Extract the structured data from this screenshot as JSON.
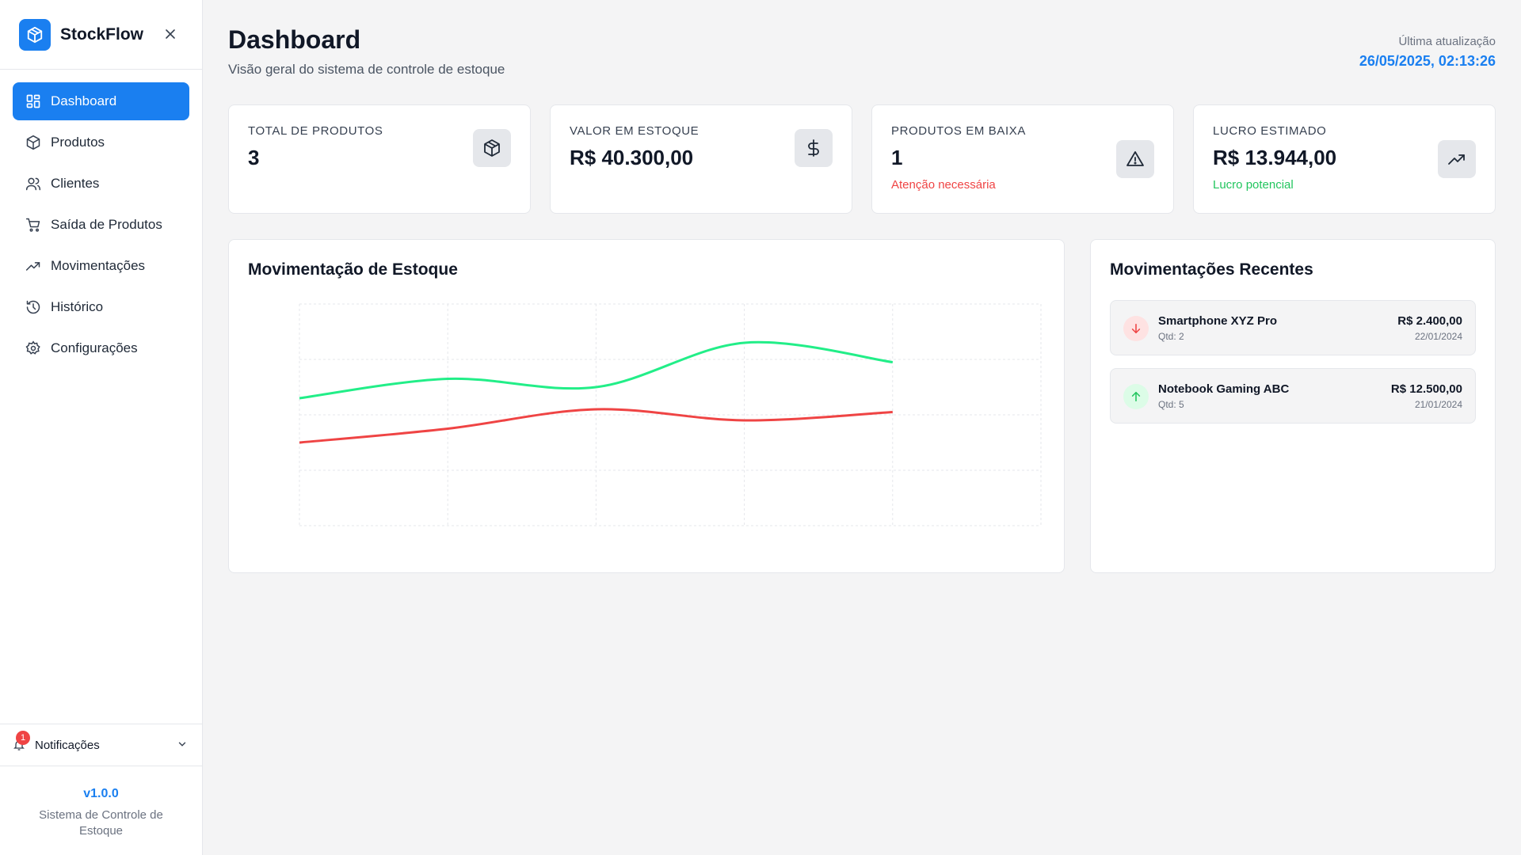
{
  "app": {
    "name": "StockFlow"
  },
  "sidebar": {
    "items": [
      {
        "label": "Dashboard",
        "icon": "dashboard-grid-icon",
        "active": true
      },
      {
        "label": "Produtos",
        "icon": "package-icon"
      },
      {
        "label": "Clientes",
        "icon": "users-icon"
      },
      {
        "label": "Saída de Produtos",
        "icon": "cart-icon"
      },
      {
        "label": "Movimentações",
        "icon": "trending-up-icon"
      },
      {
        "label": "Histórico",
        "icon": "history-icon"
      },
      {
        "label": "Configurações",
        "icon": "settings-gear-icon"
      }
    ],
    "notifications": {
      "label": "Notificações",
      "count": "1"
    },
    "footer": {
      "version": "v1.0.0",
      "subtitle": "Sistema de Controle de Estoque"
    }
  },
  "header": {
    "title": "Dashboard",
    "subtitle": "Visão geral do sistema de controle de estoque",
    "updated_label": "Última atualização",
    "updated_value": "26/05/2025, 02:13:26"
  },
  "cards": [
    {
      "label": "TOTAL DE PRODUTOS",
      "value": "3",
      "note": "",
      "icon": "package-icon"
    },
    {
      "label": "VALOR EM ESTOQUE",
      "value": "R$ 40.300,00",
      "note": "",
      "icon": "dollar-icon"
    },
    {
      "label": "PRODUTOS EM BAIXA",
      "value": "1",
      "note": "Atenção necessária",
      "note_color": "#ef4444",
      "icon": "alert-triangle-icon"
    },
    {
      "label": "LUCRO ESTIMADO",
      "value": "R$ 13.944,00",
      "note": "Lucro potencial",
      "note_color": "#22c55e",
      "icon": "trending-up-icon"
    }
  ],
  "stock_chart": {
    "title": "Movimentação de Estoque"
  },
  "chart_data": {
    "type": "line",
    "x": [
      0,
      1,
      2,
      3,
      4
    ],
    "xlim": [
      0,
      5
    ],
    "ylim": [
      0,
      4
    ],
    "grid": true,
    "series": [
      {
        "values": [
          2.3,
          2.65,
          2.5,
          3.3,
          2.95
        ],
        "color": "#22ee88"
      },
      {
        "values": [
          1.5,
          1.75,
          2.1,
          1.9,
          2.05
        ],
        "color": "#ef4444"
      }
    ]
  },
  "recent": {
    "title": "Movimentações Recentes",
    "items": [
      {
        "name": "Smartphone XYZ Pro",
        "qty": "Qtd: 2",
        "price": "R$ 2.400,00",
        "date": "22/01/2024",
        "direction": "out"
      },
      {
        "name": "Notebook Gaming ABC",
        "qty": "Qtd: 5",
        "price": "R$ 12.500,00",
        "date": "21/01/2024",
        "direction": "in"
      }
    ]
  },
  "colors": {
    "accent": "#1a7ff0",
    "danger": "#ef4444",
    "success": "#22c55e"
  }
}
